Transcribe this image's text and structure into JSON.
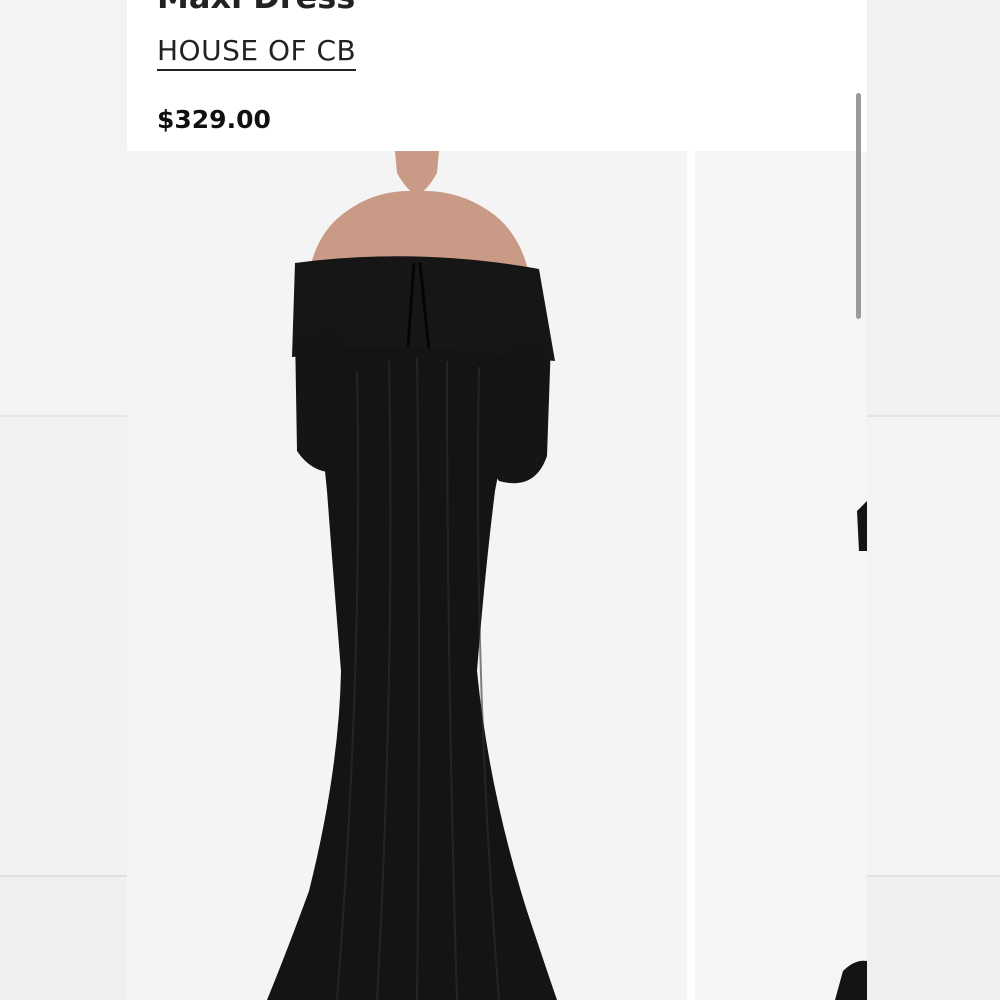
{
  "product": {
    "title": "Maxi Dress",
    "brand": "HOUSE OF CB",
    "price": "$329.00"
  },
  "gallery": {
    "main_image_alt": "Model wearing black lace off-shoulder maxi dress",
    "next_image_alt": "Second product image"
  },
  "colors": {
    "dress": "#141414",
    "skin": "#c99a86",
    "background": "#f4f4f4"
  }
}
